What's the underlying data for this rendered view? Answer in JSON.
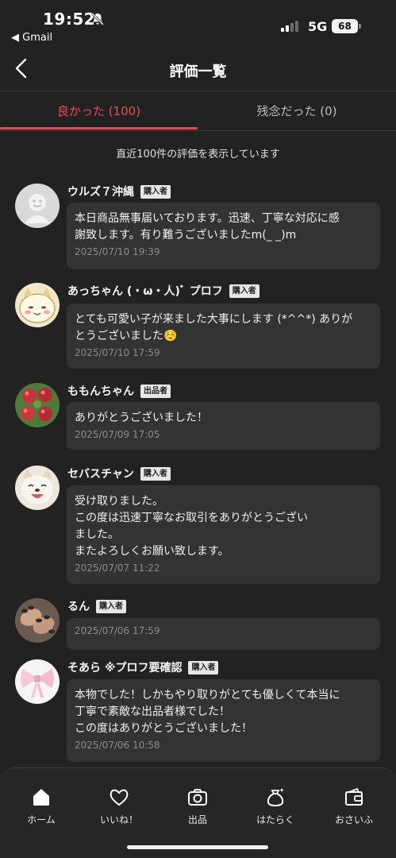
{
  "status_bar": {
    "time": "19:52",
    "back_app": "◀ Gmail",
    "network": "5G",
    "battery": "68"
  },
  "header": {
    "title": "評価一覧"
  },
  "tabs": [
    {
      "label": "良かった (100)",
      "active": true
    },
    {
      "label": "残念だった (0)",
      "active": false
    }
  ],
  "notice": "直近100件の評価を表示しています",
  "reviews": [
    {
      "name": "ウルズ７沖縄",
      "role": "購入者",
      "message": "本日商品無事届いております。迅速、丁寧な対応に感\n謝致します。有り難うございましたm(_ _)m",
      "date": "2025/07/10 19:39",
      "avatar": "default-avatar-icon"
    },
    {
      "name": "あっちゃん (・ω・人)ﾞ プロフ",
      "role": "購入者",
      "message": "とても可愛い子が来ました大事にします (*^^*) ありが\nとうございました☺️",
      "date": "2025/07/10 17:59",
      "avatar": "cat-illustration-avatar"
    },
    {
      "name": "ももんちゃん",
      "role": "出品者",
      "message": "ありがとうございました！",
      "date": "2025/07/09 17:05",
      "avatar": "peaches-photo-avatar"
    },
    {
      "name": "セバスチャン",
      "role": "購入者",
      "message": "受け取りました。\nこの度は迅速丁寧なお取引をありがとうござい\nました。\nまたよろしくお願い致します。",
      "date": "2025/07/07 11:22",
      "avatar": "smiling-dog-avatar"
    },
    {
      "name": "るん",
      "role": "購入者",
      "message": "",
      "date": "2025/07/06 17:59",
      "avatar": "nails-photo-avatar"
    },
    {
      "name": "そあら ※プロフ要確認",
      "role": "購入者",
      "message": "本物でした！しかもやり取りがとても優しくて本当に\n丁寧で素敵な出品者様でした！\nこの度はありがとうございました！",
      "date": "2025/07/06 10:58",
      "avatar": "pink-bow-avatar"
    }
  ],
  "bottom_nav": [
    {
      "label": "ホーム",
      "icon": "home-icon"
    },
    {
      "label": "いいね！",
      "icon": "heart-icon"
    },
    {
      "label": "出品",
      "icon": "camera-icon"
    },
    {
      "label": "はたらく",
      "icon": "money-bag-icon"
    },
    {
      "label": "おさいふ",
      "icon": "wallet-icon"
    }
  ],
  "colors": {
    "accent": "#e84c5a",
    "background": "#222222",
    "bubble": "#333333"
  }
}
